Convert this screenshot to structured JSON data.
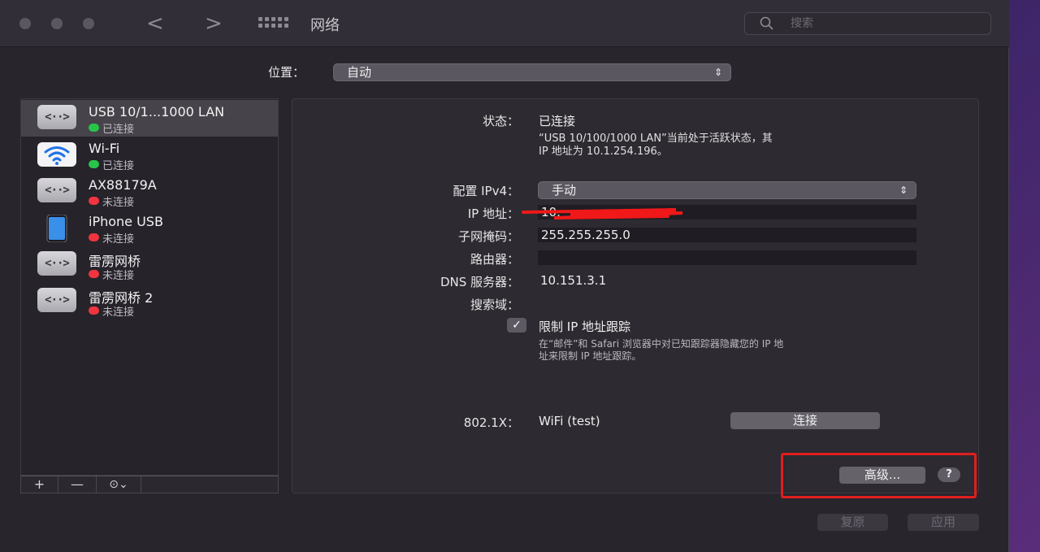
{
  "window": {
    "title": "网络",
    "back_glyph": "<",
    "forward_glyph": ">",
    "search_placeholder": "搜索"
  },
  "location": {
    "label": "位置：",
    "value": "自动"
  },
  "services": [
    {
      "name": "USB 10/1...1000 LAN",
      "status": "已连接",
      "status_color": "#29c44a",
      "icon": "ethernet-icon",
      "selected": true
    },
    {
      "name": "Wi-Fi",
      "status": "已连接",
      "status_color": "#29c44a",
      "icon": "wifi-icon"
    },
    {
      "name": "AX88179A",
      "status": "未连接",
      "status_color": "#f0353f",
      "icon": "ethernet-icon"
    },
    {
      "name": "iPhone USB",
      "status": "未连接",
      "status_color": "#f0353f",
      "icon": "iphone-icon"
    },
    {
      "name": "雷雳网桥",
      "status": "未连接",
      "status_color": "#f0353f",
      "icon": "ethernet-icon"
    },
    {
      "name": "雷雳网桥 2",
      "status": "未连接",
      "status_color": "#f0353f",
      "icon": "ethernet-icon"
    }
  ],
  "sidebar_toolbar": {
    "add": "+",
    "remove": "—",
    "action": "⊙⌄"
  },
  "detail": {
    "status_label": "状态：",
    "status_value": "已连接",
    "status_desc_line1": "“USB 10/100/1000 LAN”当前处于活跃状态，其",
    "status_desc_line2": "IP 地址为 10.1.254.196。",
    "config_label": "配置 IPv4：",
    "config_value": "手动",
    "ip_label": "IP 地址：",
    "ip_value": "10.",
    "subnet_label": "子网掩码：",
    "subnet_value": "255.255.255.0",
    "router_label": "路由器：",
    "router_value": "",
    "dns_label": "DNS 服务器：",
    "dns_value": "10.151.3.1",
    "search_domain_label": "搜索域：",
    "limit_ip_label": "限制 IP 地址跟踪",
    "limit_ip_checked": true,
    "limit_ip_note_line1": "在“邮件”和 Safari 浏览器中对已知跟踪器隐藏您的 IP 地",
    "limit_ip_note_line2": "址来限制 IP 地址跟踪。",
    "dot1x_label": "802.1X：",
    "dot1x_value": "WiFi (test)",
    "connect_button": "连接",
    "advanced_button": "高级...",
    "help_button": "?"
  },
  "footer": {
    "revert_button": "复原",
    "apply_button": "应用"
  },
  "colors": {
    "connected": "#29c44a",
    "disconnected": "#f0353f",
    "highlight_box": "#e01e1e"
  }
}
